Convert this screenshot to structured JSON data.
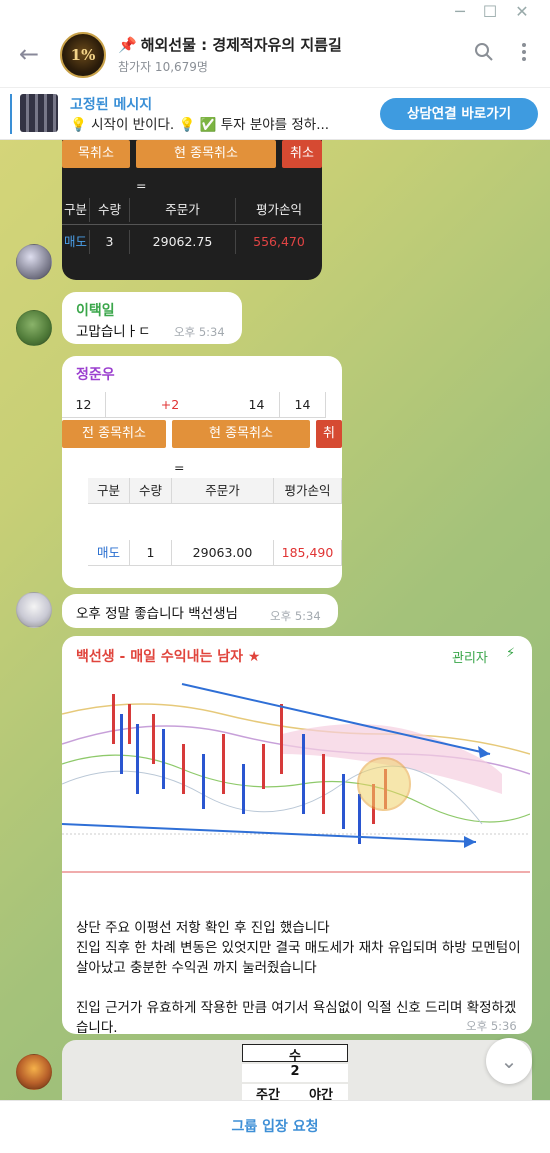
{
  "window": {
    "minimize": "─",
    "maximize": "☐",
    "close": "✕"
  },
  "header": {
    "back_icon": "←",
    "avatar_text": "1%",
    "title_pin": "📌",
    "title": "해외선물 : 경제적자유의 지름길",
    "subscribers": "참가자 10,679명"
  },
  "pinned": {
    "label": "고정된 메시지",
    "text": "💡 시작이 반이다. 💡 ✅ 투자 분야를 정하...",
    "button": "상담연결 바로가기"
  },
  "messages": [
    {
      "type": "trade-screenshot-dark",
      "buttons": [
        "목취소",
        "현 종목취소",
        "취소"
      ],
      "equals": "=",
      "columns": [
        "구분",
        "수량",
        "주문가",
        "평가손익"
      ],
      "row": [
        "매도",
        "3",
        "29062.75",
        "556,470"
      ]
    },
    {
      "sender": "이택일",
      "sender_color": "#3aa64a",
      "text": "고맙습니ㅏㄷ",
      "time": "오후 5:34"
    },
    {
      "sender": "정준우",
      "sender_color": "#9b3fcf",
      "top_row": [
        "12",
        "+2",
        "14",
        "14"
      ],
      "buttons": [
        "전 종목취소",
        "현 종목취소",
        "취"
      ],
      "equals": "=",
      "columns": [
        "구분",
        "수량",
        "주문가",
        "평가손익"
      ],
      "row": [
        "매도",
        "1",
        "29063.00",
        "185,490"
      ]
    },
    {
      "text": "오후 정말 좋습니다 백선생님",
      "time": "오후 5:34"
    },
    {
      "sender": "백선생 - 매일 수익내는 남자 ★",
      "sender_color": "#e0443c",
      "role": "관리자",
      "role_icon": "⚡",
      "text_lines": [
        "상단 주요 이평선 저항 확인 후 진입 했습니다",
        "진입 직후 한 차례 변동은 있엇지만 결국 매도세가 재차 유입되며 하방 모멘텀이 살아났고 충분한 수익권 까지 눌러줬습니다",
        "",
        "진입 근거가 유효하게 작용한 만큼 여기서 욕심없이 익절 신호 드리며 확정하겠습니다."
      ],
      "time": "오후 5:36"
    },
    {
      "type": "partial-image",
      "cells": [
        "수",
        "2",
        "주간",
        "야간"
      ]
    }
  ],
  "bottom": {
    "join": "그룹 입장 요청",
    "scroll_icon": "chevron-down-icon"
  }
}
